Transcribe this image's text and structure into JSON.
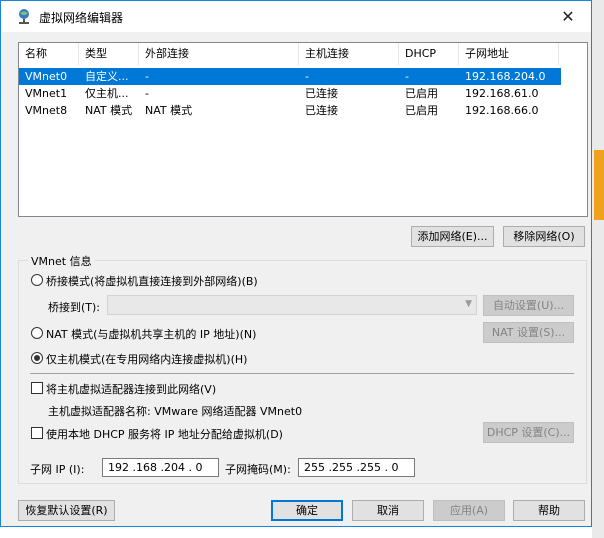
{
  "window": {
    "title": "虚拟网络编辑器",
    "icon": "network-globe-icon",
    "close_label": "✕"
  },
  "table": {
    "headers": [
      "名称",
      "类型",
      "外部连接",
      "主机连接",
      "DHCP",
      "子网地址"
    ],
    "rows": [
      [
        "VMnet0",
        "自定义...",
        "-",
        "-",
        "-",
        "192.168.204.0"
      ],
      [
        "VMnet1",
        "仅主机...",
        "-",
        "已连接",
        "已启用",
        "192.168.61.0"
      ],
      [
        "VMnet8",
        "NAT 模式",
        "NAT 模式",
        "已连接",
        "已启用",
        "192.168.66.0"
      ]
    ],
    "selected_row": 0
  },
  "buttons": {
    "add_network": "添加网络(E)...",
    "remove_network": "移除网络(O)",
    "auto_settings": "自动设置(U)...",
    "nat_settings": "NAT 设置(S)...",
    "dhcp_settings": "DHCP 设置(C)...",
    "restore_defaults": "恢复默认设置(R)",
    "ok": "确定",
    "cancel": "取消",
    "apply": "应用(A)",
    "help": "帮助"
  },
  "vmnet_info": {
    "label": "VMnet 信息",
    "bridge_mode": "桥接模式(将虚拟机直接连接到外部网络)(B)",
    "bridge_to_label": "桥接到(T):",
    "bridge_to_value": "",
    "nat_mode": "NAT 模式(与虚拟机共享主机的 IP 地址)(N)",
    "host_only_mode": "仅主机模式(在专用网络内连接虚拟机)(H)",
    "selected_mode": "host_only",
    "connect_adapter": "将主机虚拟适配器连接到此网络(V)",
    "connect_adapter_checked": false,
    "adapter_name": "主机虚拟适配器名称: VMware 网络适配器 VMnet0",
    "use_dhcp": "使用本地 DHCP 服务将 IP 地址分配给虚拟机(D)",
    "use_dhcp_checked": false,
    "subnet_ip_label": "子网 IP (I):",
    "subnet_ip_value": "192 .168 .204 . 0",
    "subnet_mask_label": "子网掩码(M):",
    "subnet_mask_value": "255 .255 .255 . 0"
  },
  "colors": {
    "selection": "#0078d7",
    "accent_border": "#0078d7"
  }
}
